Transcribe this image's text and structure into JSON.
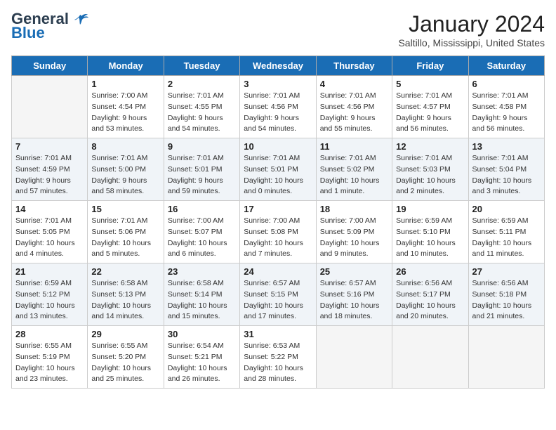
{
  "header": {
    "logo_general": "General",
    "logo_blue": "Blue",
    "month_year": "January 2024",
    "location": "Saltillo, Mississippi, United States"
  },
  "days_of_week": [
    "Sunday",
    "Monday",
    "Tuesday",
    "Wednesday",
    "Thursday",
    "Friday",
    "Saturday"
  ],
  "weeks": [
    [
      {
        "day": "",
        "sunrise": "",
        "sunset": "",
        "daylight": ""
      },
      {
        "day": "1",
        "sunrise": "Sunrise: 7:00 AM",
        "sunset": "Sunset: 4:54 PM",
        "daylight": "Daylight: 9 hours and 53 minutes."
      },
      {
        "day": "2",
        "sunrise": "Sunrise: 7:01 AM",
        "sunset": "Sunset: 4:55 PM",
        "daylight": "Daylight: 9 hours and 54 minutes."
      },
      {
        "day": "3",
        "sunrise": "Sunrise: 7:01 AM",
        "sunset": "Sunset: 4:56 PM",
        "daylight": "Daylight: 9 hours and 54 minutes."
      },
      {
        "day": "4",
        "sunrise": "Sunrise: 7:01 AM",
        "sunset": "Sunset: 4:56 PM",
        "daylight": "Daylight: 9 hours and 55 minutes."
      },
      {
        "day": "5",
        "sunrise": "Sunrise: 7:01 AM",
        "sunset": "Sunset: 4:57 PM",
        "daylight": "Daylight: 9 hours and 56 minutes."
      },
      {
        "day": "6",
        "sunrise": "Sunrise: 7:01 AM",
        "sunset": "Sunset: 4:58 PM",
        "daylight": "Daylight: 9 hours and 56 minutes."
      }
    ],
    [
      {
        "day": "7",
        "sunrise": "Sunrise: 7:01 AM",
        "sunset": "Sunset: 4:59 PM",
        "daylight": "Daylight: 9 hours and 57 minutes."
      },
      {
        "day": "8",
        "sunrise": "Sunrise: 7:01 AM",
        "sunset": "Sunset: 5:00 PM",
        "daylight": "Daylight: 9 hours and 58 minutes."
      },
      {
        "day": "9",
        "sunrise": "Sunrise: 7:01 AM",
        "sunset": "Sunset: 5:01 PM",
        "daylight": "Daylight: 9 hours and 59 minutes."
      },
      {
        "day": "10",
        "sunrise": "Sunrise: 7:01 AM",
        "sunset": "Sunset: 5:01 PM",
        "daylight": "Daylight: 10 hours and 0 minutes."
      },
      {
        "day": "11",
        "sunrise": "Sunrise: 7:01 AM",
        "sunset": "Sunset: 5:02 PM",
        "daylight": "Daylight: 10 hours and 1 minute."
      },
      {
        "day": "12",
        "sunrise": "Sunrise: 7:01 AM",
        "sunset": "Sunset: 5:03 PM",
        "daylight": "Daylight: 10 hours and 2 minutes."
      },
      {
        "day": "13",
        "sunrise": "Sunrise: 7:01 AM",
        "sunset": "Sunset: 5:04 PM",
        "daylight": "Daylight: 10 hours and 3 minutes."
      }
    ],
    [
      {
        "day": "14",
        "sunrise": "Sunrise: 7:01 AM",
        "sunset": "Sunset: 5:05 PM",
        "daylight": "Daylight: 10 hours and 4 minutes."
      },
      {
        "day": "15",
        "sunrise": "Sunrise: 7:01 AM",
        "sunset": "Sunset: 5:06 PM",
        "daylight": "Daylight: 10 hours and 5 minutes."
      },
      {
        "day": "16",
        "sunrise": "Sunrise: 7:00 AM",
        "sunset": "Sunset: 5:07 PM",
        "daylight": "Daylight: 10 hours and 6 minutes."
      },
      {
        "day": "17",
        "sunrise": "Sunrise: 7:00 AM",
        "sunset": "Sunset: 5:08 PM",
        "daylight": "Daylight: 10 hours and 7 minutes."
      },
      {
        "day": "18",
        "sunrise": "Sunrise: 7:00 AM",
        "sunset": "Sunset: 5:09 PM",
        "daylight": "Daylight: 10 hours and 9 minutes."
      },
      {
        "day": "19",
        "sunrise": "Sunrise: 6:59 AM",
        "sunset": "Sunset: 5:10 PM",
        "daylight": "Daylight: 10 hours and 10 minutes."
      },
      {
        "day": "20",
        "sunrise": "Sunrise: 6:59 AM",
        "sunset": "Sunset: 5:11 PM",
        "daylight": "Daylight: 10 hours and 11 minutes."
      }
    ],
    [
      {
        "day": "21",
        "sunrise": "Sunrise: 6:59 AM",
        "sunset": "Sunset: 5:12 PM",
        "daylight": "Daylight: 10 hours and 13 minutes."
      },
      {
        "day": "22",
        "sunrise": "Sunrise: 6:58 AM",
        "sunset": "Sunset: 5:13 PM",
        "daylight": "Daylight: 10 hours and 14 minutes."
      },
      {
        "day": "23",
        "sunrise": "Sunrise: 6:58 AM",
        "sunset": "Sunset: 5:14 PM",
        "daylight": "Daylight: 10 hours and 15 minutes."
      },
      {
        "day": "24",
        "sunrise": "Sunrise: 6:57 AM",
        "sunset": "Sunset: 5:15 PM",
        "daylight": "Daylight: 10 hours and 17 minutes."
      },
      {
        "day": "25",
        "sunrise": "Sunrise: 6:57 AM",
        "sunset": "Sunset: 5:16 PM",
        "daylight": "Daylight: 10 hours and 18 minutes."
      },
      {
        "day": "26",
        "sunrise": "Sunrise: 6:56 AM",
        "sunset": "Sunset: 5:17 PM",
        "daylight": "Daylight: 10 hours and 20 minutes."
      },
      {
        "day": "27",
        "sunrise": "Sunrise: 6:56 AM",
        "sunset": "Sunset: 5:18 PM",
        "daylight": "Daylight: 10 hours and 21 minutes."
      }
    ],
    [
      {
        "day": "28",
        "sunrise": "Sunrise: 6:55 AM",
        "sunset": "Sunset: 5:19 PM",
        "daylight": "Daylight: 10 hours and 23 minutes."
      },
      {
        "day": "29",
        "sunrise": "Sunrise: 6:55 AM",
        "sunset": "Sunset: 5:20 PM",
        "daylight": "Daylight: 10 hours and 25 minutes."
      },
      {
        "day": "30",
        "sunrise": "Sunrise: 6:54 AM",
        "sunset": "Sunset: 5:21 PM",
        "daylight": "Daylight: 10 hours and 26 minutes."
      },
      {
        "day": "31",
        "sunrise": "Sunrise: 6:53 AM",
        "sunset": "Sunset: 5:22 PM",
        "daylight": "Daylight: 10 hours and 28 minutes."
      },
      {
        "day": "",
        "sunrise": "",
        "sunset": "",
        "daylight": ""
      },
      {
        "day": "",
        "sunrise": "",
        "sunset": "",
        "daylight": ""
      },
      {
        "day": "",
        "sunrise": "",
        "sunset": "",
        "daylight": ""
      }
    ]
  ]
}
